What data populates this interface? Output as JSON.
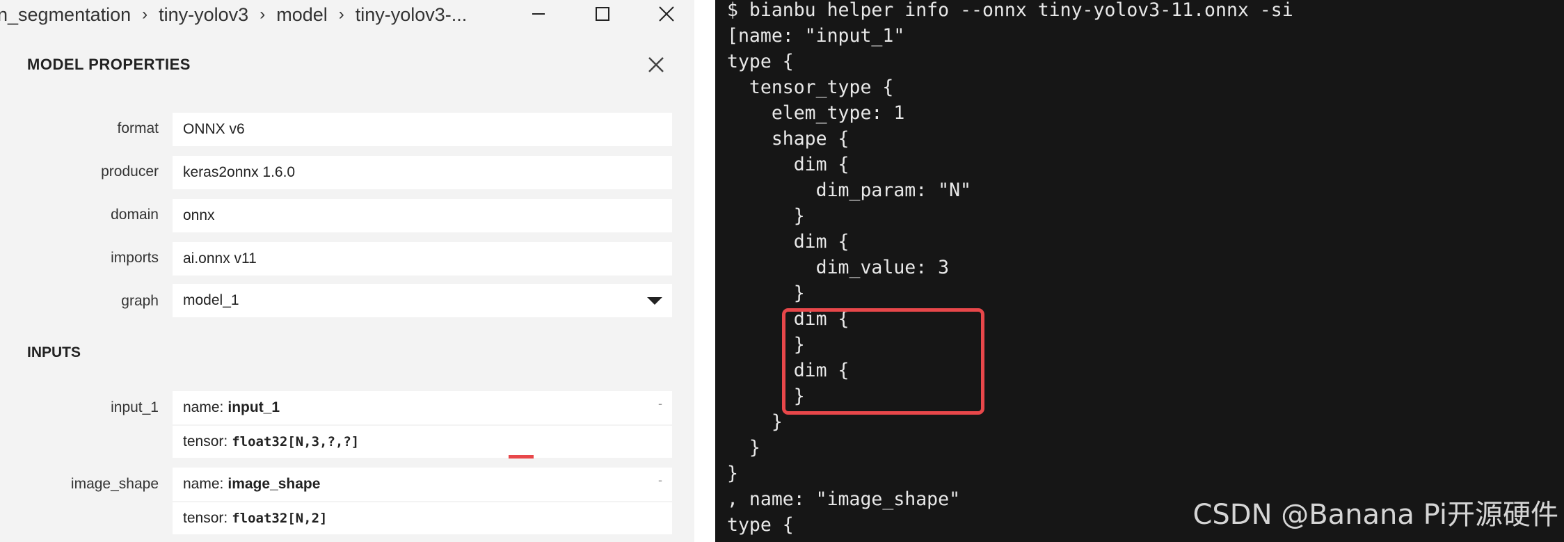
{
  "window": {
    "breadcrumb": [
      "n_segmentation",
      "tiny-yolov3",
      "model",
      "tiny-yolov3-..."
    ]
  },
  "panel": {
    "title": "MODEL PROPERTIES",
    "properties": [
      {
        "label": "format",
        "value": "ONNX v6"
      },
      {
        "label": "producer",
        "value": "keras2onnx 1.6.0"
      },
      {
        "label": "domain",
        "value": "onnx"
      },
      {
        "label": "imports",
        "value": "ai.onnx v11"
      },
      {
        "label": "graph",
        "value": "model_1"
      }
    ],
    "inputs_title": "INPUTS",
    "inputs": [
      {
        "label": "input_1",
        "name_key": "name:",
        "name": "input_1",
        "tensor_key": "tensor:",
        "tensor": "float32[N,3,?,?]",
        "toggle": "-"
      },
      {
        "label": "image_shape",
        "name_key": "name:",
        "name": "image_shape",
        "tensor_key": "tensor:",
        "tensor": "float32[N,2]",
        "toggle": "-"
      }
    ]
  },
  "terminal": {
    "lines": [
      "$ bianbu helper info --onnx tiny-yolov3-11.onnx -si",
      "[name: \"input_1\"",
      "type {",
      "  tensor_type {",
      "    elem_type: 1",
      "    shape {",
      "      dim {",
      "        dim_param: \"N\"",
      "      }",
      "      dim {",
      "        dim_value: 3",
      "      }",
      "      dim {",
      "      }",
      "      dim {",
      "      }",
      "    }",
      "  }",
      "}",
      ", name: \"image_shape\"",
      "type {"
    ],
    "watermark": "CSDN @Banana Pi开源硬件"
  },
  "colors": {
    "highlight": "#e8474a",
    "terminal_bg": "#161616",
    "panel_bg": "#f3f3f3"
  }
}
